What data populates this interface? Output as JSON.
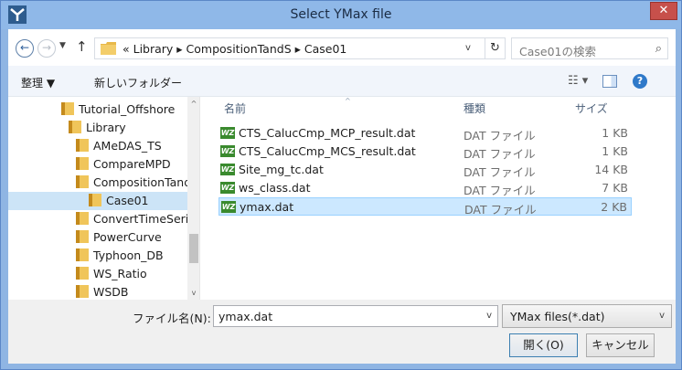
{
  "window": {
    "title": "Select YMax file",
    "close_label": "✕",
    "app_icon": "app-logo-icon"
  },
  "address": {
    "back_glyph": "←",
    "forward_glyph": "→",
    "recent_glyph": "▼",
    "up_glyph": "↑",
    "path_text": "« Library ▸ CompositionTandS ▸ Case01",
    "dropdown_glyph": "v",
    "refresh_glyph": "↻",
    "search_placeholder": "Case01の検索",
    "search_icon_glyph": "⌕"
  },
  "toolbar": {
    "organize_label": "整理 ▼",
    "new_folder_label": "新しいフォルダー",
    "view_glyph": "☷ ▾",
    "help_glyph": "?"
  },
  "nav_tree": [
    {
      "label": "Tutorial_Offshore",
      "selected": false
    },
    {
      "label": "Library",
      "selected": false
    },
    {
      "label": "AMeDAS_TS",
      "selected": false
    },
    {
      "label": "CompareMPD",
      "selected": false
    },
    {
      "label": "CompositionTand",
      "selected": false
    },
    {
      "label": "Case01",
      "selected": true
    },
    {
      "label": "ConvertTimeSeri",
      "selected": false
    },
    {
      "label": "PowerCurve",
      "selected": false
    },
    {
      "label": "Typhoon_DB",
      "selected": false
    },
    {
      "label": "WS_Ratio",
      "selected": false
    },
    {
      "label": "WSDB",
      "selected": false
    }
  ],
  "nav_scroll": {
    "up_glyph": "^",
    "down_glyph": "v"
  },
  "file_list": {
    "columns": {
      "name": "名前",
      "type": "種類",
      "size": "サイズ"
    },
    "sort_glyph": "^",
    "icon_text": "WZ",
    "rows": [
      {
        "name": "CTS_CalucCmp_MCP_result.dat",
        "type": "DAT ファイル",
        "size": "1 KB",
        "selected": false
      },
      {
        "name": "CTS_CalucCmp_MCS_result.dat",
        "type": "DAT ファイル",
        "size": "1 KB",
        "selected": false
      },
      {
        "name": "Site_mg_tc.dat",
        "type": "DAT ファイル",
        "size": "14 KB",
        "selected": false
      },
      {
        "name": "ws_class.dat",
        "type": "DAT ファイル",
        "size": "7 KB",
        "selected": false
      },
      {
        "name": "ymax.dat",
        "type": "DAT ファイル",
        "size": "2 KB",
        "selected": true
      }
    ]
  },
  "bottom": {
    "filename_label": "ファイル名(N):",
    "filename_value": "ymax.dat",
    "filename_dropdown_glyph": "v",
    "filter_value": "YMax files(*.dat)",
    "filter_dropdown_glyph": "v",
    "open_label": "開く(O)",
    "cancel_label": "キャンセル"
  },
  "colors": {
    "titlebar": "#8fb8e8",
    "close_button": "#c7504b",
    "selection": "#cce8ff",
    "folder": "#e8b94a",
    "file_icon": "#3a8a2e"
  }
}
